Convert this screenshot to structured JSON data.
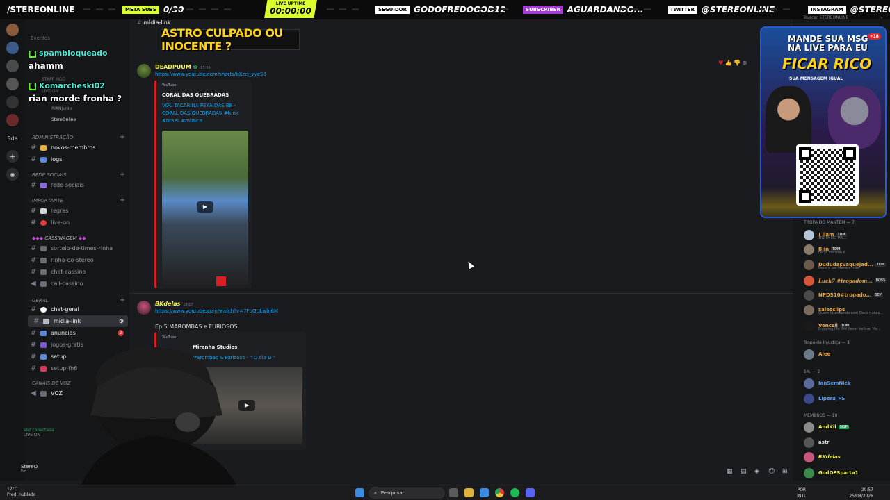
{
  "stream_bar": {
    "channel": "/STEREONLINE",
    "meta_label": "META SUBS",
    "meta_value": "0/30",
    "uptime_label": "LIVE UPTIME",
    "uptime_value": "00:00:00",
    "follower_label": "SEGUIDOR",
    "follower_value": "GODOFREDOGOD12",
    "subscriber_label": "SUBSCRIBER",
    "subscriber_value": "AGUARDANDO...",
    "twitter_label": "TWITTER",
    "twitter_value": "@STEREONLINE",
    "instagram_label": "INSTAGRAM",
    "instagram_value": "@STEREONLINE"
  },
  "chat_overlay": [
    {
      "user": "spambloqueado",
      "message": "ahamm"
    },
    {
      "user": "Komarcheski02",
      "message": "rian morde fronha ?"
    }
  ],
  "server_list": {
    "label": "Sda"
  },
  "channel_sidebar": {
    "top_items": [
      "Eventos",
      "STAFF MOD",
      "LIVE ON",
      "RIANjunio",
      "StereOnline"
    ],
    "categories": [
      {
        "name": "ADMINISTRAÇÃO",
        "channels": [
          "novos-membros",
          "logs"
        ]
      },
      {
        "name": "REDE SOCIAIS",
        "channels": [
          "rede-sociais"
        ]
      },
      {
        "name": "IMPORTANTE",
        "channels": [
          "regras",
          "live-on"
        ]
      },
      {
        "name": "CASSINAGEM",
        "channels": [
          "sorteio-de-times-rinha",
          "rinha-do-stereo",
          "chat-cassino",
          "call-cassino"
        ]
      },
      {
        "name": "GERAL",
        "channels": [
          "chat-geral",
          "mídia-link",
          "anuncios",
          "jogos-gratis",
          "setup",
          "setup-fh6"
        ]
      },
      {
        "name": "CANAIS DE VOZ",
        "channels": [
          "VOZ"
        ]
      }
    ],
    "unread_badge": "2",
    "voice_status": "Voz conectada",
    "voice_sub": "LIVE ON",
    "user_name": "StereO",
    "user_status": "Em"
  },
  "main": {
    "channel_title": "mídia-link",
    "banner_text": "ASTRO CULPADO OU INOCENTE ?",
    "messages": [
      {
        "author": "DEADPUUM",
        "time": "17:56",
        "link": "https://www.youtube.com/shorts/bXzcj_yyeS8",
        "embed_provider": "YouTube",
        "embed_author": "CORAL DAS QUEBRADAS",
        "embed_title": "VOU TACAR NA PEKA DAS BB - CORAL DAS QUEBRADAS #funk #brazil #musica"
      },
      {
        "author": "BKdelas",
        "time": "18:07",
        "link": "https://www.youtube.com/watch?v=7FbQULwbj6M",
        "text": "Ep 5 MAROMBAS e FURIOSOS",
        "embed_provider": "YouTube",
        "embed_author": "Miranha Studios",
        "embed_title": "Marombas & Furiosos - \" O dia D \""
      }
    ]
  },
  "member_list": {
    "search_placeholder": "Buscar STEREONLINE",
    "sections": [
      {
        "title": "TROPA DO MANTEM — 7",
        "members": [
          {
            "name": "! liam",
            "tag": "TDM",
            "sub": "TROPA DO MA...",
            "color": "#e7a43b"
          },
          {
            "name": "Biin",
            "tag": "TDM",
            "sub": "Forza Horizon 6",
            "color": "#e7a43b"
          },
          {
            "name": "Dududasvaquejad...",
            "tag": "TDM",
            "sub": "Deus e pai Mana e mãe",
            "color": "#e7a43b"
          },
          {
            "name": "Luck7 #tropadom...",
            "tag": "BOSS",
            "sub": "",
            "color": "#e7a43b"
          },
          {
            "name": "NPDS10#tropado...",
            "tag": "SEP",
            "sub": "",
            "color": "#e7a43b"
          },
          {
            "name": "salesclips",
            "tag": "",
            "sub": "Quem tá andando com Deus nunca...",
            "color": "#e7a43b"
          },
          {
            "name": "Vencsil",
            "tag": "TDM",
            "sub": "Enjoying life like never before. Mo...",
            "color": "#e7a43b"
          }
        ]
      },
      {
        "title": "Tropa da Injustiça — 1",
        "members": [
          {
            "name": "Alee",
            "tag": "",
            "sub": "",
            "color": "#e7a43b"
          }
        ]
      },
      {
        "title": "5% — 2",
        "members": [
          {
            "name": "IanSemNick",
            "tag": "",
            "sub": "",
            "color": "#5b9cf0"
          },
          {
            "name": "Lipera_FS",
            "tag": "",
            "sub": "",
            "color": "#5b9cf0"
          }
        ]
      },
      {
        "title": "MEMBROS — 10",
        "members": [
          {
            "name": "AndKil",
            "tag": "SKIP",
            "sub": "",
            "color": "#f2f34e"
          },
          {
            "name": "astr",
            "tag": "",
            "sub": "",
            "color": "#dbdee1"
          },
          {
            "name": "BKdelas",
            "tag": "",
            "sub": "",
            "color": "#f2f34e"
          },
          {
            "name": "GodOFSparta1",
            "tag": "",
            "sub": "",
            "color": "#f2f34e"
          }
        ]
      }
    ]
  },
  "promo": {
    "line1": "MANDE SUA MSG NA LIVE PARA EU",
    "line2": "FICAR RICO",
    "line3": "SUA MENSAGEM IGUAL",
    "badge": "+18"
  },
  "taskbar": {
    "search_label": "Pesquisar",
    "weather_temp": "17°C",
    "weather_desc": "Pred. nublado",
    "lang": "POR",
    "lang_sub": "INTL",
    "time": "20:57",
    "date": "25/08/2026"
  },
  "colors": {
    "accent_yellow": "#d9ff2f",
    "link_blue": "#00a8fc",
    "embed_red": "#d91f26",
    "chat_cyan": "#4ee6d4"
  }
}
